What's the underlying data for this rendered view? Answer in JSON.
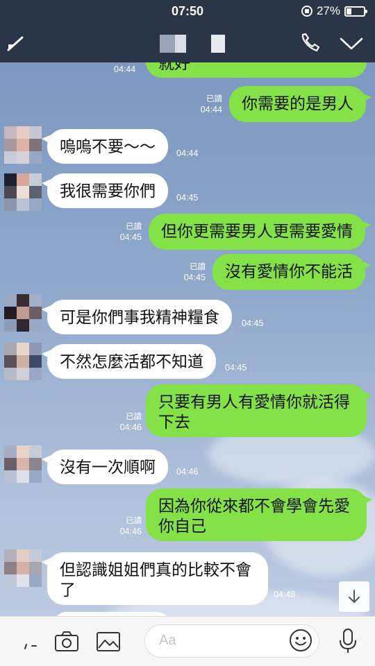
{
  "status_bar": {
    "time": "07:50",
    "battery": "27%"
  },
  "messages": [
    {
      "id": "m0",
      "side": "mine",
      "text": "就好",
      "read": "",
      "time": "04:44"
    },
    {
      "id": "m1",
      "side": "mine",
      "text": "你需要的是男人",
      "read": "已讀",
      "time": "04:44"
    },
    {
      "id": "m2",
      "side": "theirs",
      "text": "嗚嗚不要～～",
      "time": "04:44"
    },
    {
      "id": "m3",
      "side": "theirs",
      "text": "我很需要你們",
      "time": "04:45"
    },
    {
      "id": "m4",
      "side": "mine",
      "text": "但你更需要男人更需要愛情",
      "read": "已讀",
      "time": "04:45"
    },
    {
      "id": "m5",
      "side": "mine",
      "text": "沒有愛情你不能活",
      "read": "已讀",
      "time": "04:45"
    },
    {
      "id": "m6",
      "side": "theirs",
      "text": "可是你們事我精神糧食",
      "time": "04:45"
    },
    {
      "id": "m7",
      "side": "theirs",
      "text": "不然怎麼活都不知道",
      "time": "04:45"
    },
    {
      "id": "m8",
      "side": "mine",
      "lines": [
        "只要有男人有愛情你就活得",
        "下去"
      ],
      "read": "已讀",
      "time": "04:46"
    },
    {
      "id": "m9",
      "side": "theirs",
      "text": "沒有一次順啊",
      "time": "04:46"
    },
    {
      "id": "m10",
      "side": "mine",
      "lines": [
        "因為你從來都不會學會先愛",
        "你自己"
      ],
      "read": "已讀",
      "time": "04:46"
    },
    {
      "id": "m11",
      "side": "theirs",
      "lines": [
        "但認識姐姐們真的比較不會",
        "了"
      ],
      "time": "04:48"
    }
  ],
  "input": {
    "placeholder": "Aa"
  },
  "icons": {
    "header": [
      "back-icon",
      "phone-icon",
      "chevron-down-icon"
    ],
    "input": [
      "expand-icon",
      "camera-icon",
      "image-icon",
      "emoji-icon",
      "mic-icon"
    ],
    "scroll": "arrow-down-icon"
  },
  "colors": {
    "header_bg": "#2a3548",
    "my_bubble": "#84e248",
    "their_bubble": "#ffffff",
    "chat_bg": "#8ea6c9"
  }
}
